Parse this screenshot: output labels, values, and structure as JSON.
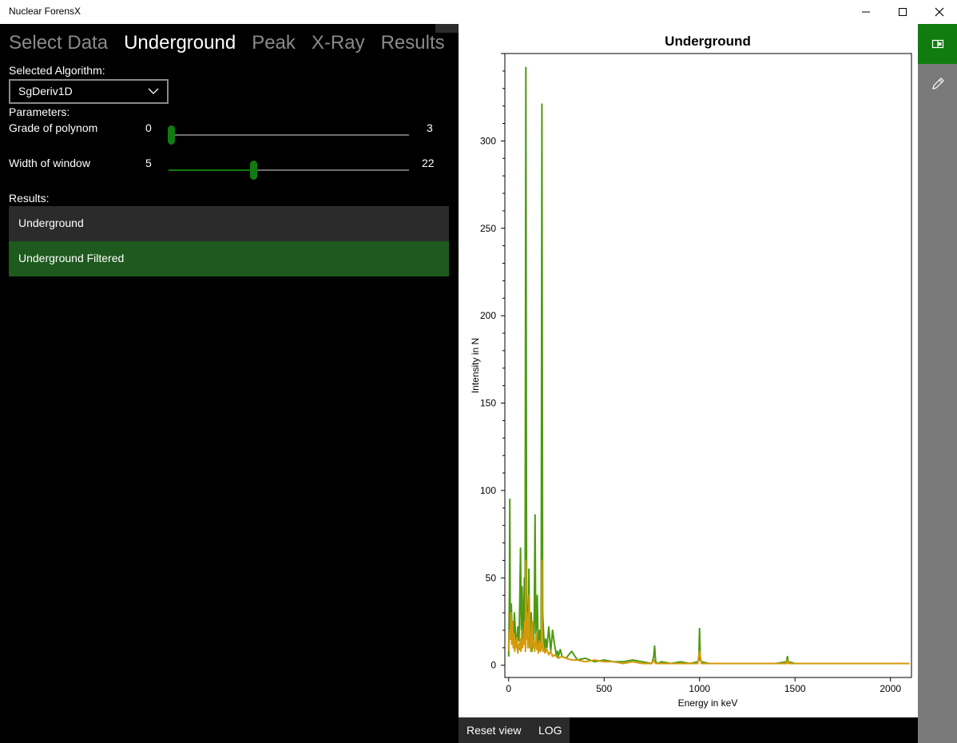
{
  "window": {
    "title": "Nuclear ForensX",
    "minimize_glyph": "—",
    "maximize_glyph": "☐",
    "close_glyph": "✕"
  },
  "tabs": [
    {
      "label": "Select Data",
      "active": false
    },
    {
      "label": "Underground",
      "active": true
    },
    {
      "label": "Peak",
      "active": false
    },
    {
      "label": "X-Ray",
      "active": false
    },
    {
      "label": "Results",
      "active": false
    }
  ],
  "algorithm": {
    "label": "Selected Algorithm:",
    "value": "SgDeriv1D"
  },
  "parameters": {
    "label": "Parameters:",
    "grade": {
      "label": "Grade of polynom",
      "min": "0",
      "max": "3",
      "value": 0
    },
    "width": {
      "label": "Width of window",
      "min": "5",
      "max": "22",
      "value": 11
    }
  },
  "results": {
    "label": "Results:",
    "items": [
      {
        "label": "Underground",
        "selected": false
      },
      {
        "label": "Underground Filtered",
        "selected": true
      }
    ]
  },
  "commands": {
    "reset": "Reset view",
    "log": "LOG"
  },
  "colors": {
    "accent": "#107c10",
    "selected_row": "#1e5a1e",
    "unselected_row": "#2b2b2b",
    "series_raw": "#4f9a12",
    "series_filtered": "#d59a0a"
  },
  "rail_icons": [
    "split-view-icon",
    "pencil-icon"
  ],
  "chart_data": {
    "type": "line",
    "title": "Underground",
    "xlabel": "Energy in keV",
    "ylabel": "Intensity in N",
    "xlim": [
      -20,
      2110
    ],
    "ylim": [
      -7,
      350
    ],
    "xticks": [
      0,
      500,
      1000,
      1500,
      2000
    ],
    "yticks": [
      0,
      50,
      100,
      150,
      200,
      250,
      300
    ],
    "grid": false,
    "series": [
      {
        "color": "#4f9a12",
        "x": [
          0,
          4,
          6,
          8,
          10,
          14,
          18,
          22,
          26,
          30,
          36,
          42,
          48,
          54,
          58,
          62,
          66,
          70,
          74,
          78,
          82,
          86,
          90,
          94,
          98,
          102,
          106,
          110,
          114,
          118,
          122,
          126,
          130,
          134,
          138,
          142,
          146,
          150,
          154,
          158,
          162,
          166,
          170,
          174,
          178,
          182,
          186,
          190,
          194,
          200,
          210,
          220,
          230,
          240,
          250,
          255,
          260,
          270,
          280,
          300,
          330,
          360,
          400,
          450,
          500,
          550,
          600,
          650,
          700,
          750,
          760,
          764,
          770,
          780,
          800,
          850,
          900,
          950,
          990,
          996,
          1000,
          1004,
          1010,
          1050,
          1100,
          1200,
          1300,
          1400,
          1455,
          1460,
          1465,
          1500,
          1600,
          1700,
          1800,
          1900,
          2000,
          2050,
          2100
        ],
        "y": [
          5,
          40,
          95,
          30,
          20,
          35,
          15,
          25,
          12,
          30,
          18,
          10,
          22,
          14,
          35,
          67,
          20,
          45,
          25,
          15,
          50,
          20,
          342,
          40,
          25,
          15,
          55,
          10,
          12,
          30,
          8,
          20,
          10,
          30,
          86,
          18,
          25,
          40,
          12,
          8,
          20,
          15,
          12,
          321,
          30,
          20,
          12,
          8,
          15,
          10,
          22,
          8,
          20,
          12,
          6,
          8,
          5,
          9,
          5,
          4,
          8,
          3,
          4,
          2,
          3,
          2,
          2,
          3,
          2,
          1,
          5,
          11,
          2,
          1,
          2,
          1,
          2,
          1,
          2,
          3,
          21,
          3,
          2,
          1,
          1,
          1,
          1,
          1,
          2,
          5,
          2,
          1,
          1,
          1,
          1,
          1,
          1,
          1,
          1
        ]
      },
      {
        "color": "#d59a0a",
        "x": [
          0,
          4,
          8,
          12,
          16,
          20,
          24,
          28,
          32,
          36,
          40,
          44,
          48,
          52,
          56,
          60,
          64,
          68,
          72,
          76,
          80,
          84,
          88,
          90,
          92,
          96,
          100,
          104,
          108,
          112,
          116,
          120,
          124,
          128,
          132,
          136,
          140,
          144,
          148,
          152,
          156,
          160,
          164,
          168,
          172,
          174,
          176,
          180,
          184,
          190,
          200,
          210,
          220,
          230,
          240,
          260,
          280,
          300,
          330,
          360,
          400,
          450,
          500,
          550,
          600,
          650,
          700,
          750,
          760,
          770,
          800,
          850,
          900,
          950,
          990,
          1000,
          1010,
          1050,
          1100,
          1200,
          1300,
          1400,
          1455,
          1460,
          1465,
          1500,
          1600,
          1700,
          1800,
          1900,
          2000,
          2050,
          2100
        ],
        "y": [
          8,
          20,
          15,
          30,
          12,
          25,
          10,
          18,
          8,
          14,
          10,
          16,
          7,
          12,
          9,
          15,
          8,
          20,
          10,
          14,
          12,
          25,
          8,
          60,
          15,
          30,
          10,
          20,
          40,
          12,
          8,
          15,
          25,
          10,
          14,
          8,
          12,
          18,
          9,
          12,
          7,
          14,
          10,
          8,
          15,
          60,
          12,
          8,
          10,
          7,
          9,
          6,
          8,
          5,
          6,
          4,
          5,
          4,
          3,
          3,
          2,
          3,
          2,
          2,
          1,
          2,
          1,
          1,
          3,
          1,
          1,
          1,
          1,
          1,
          1,
          8,
          1,
          1,
          1,
          1,
          1,
          1,
          1,
          3,
          1,
          1,
          1,
          1,
          1,
          1,
          1,
          1,
          1
        ]
      }
    ]
  }
}
